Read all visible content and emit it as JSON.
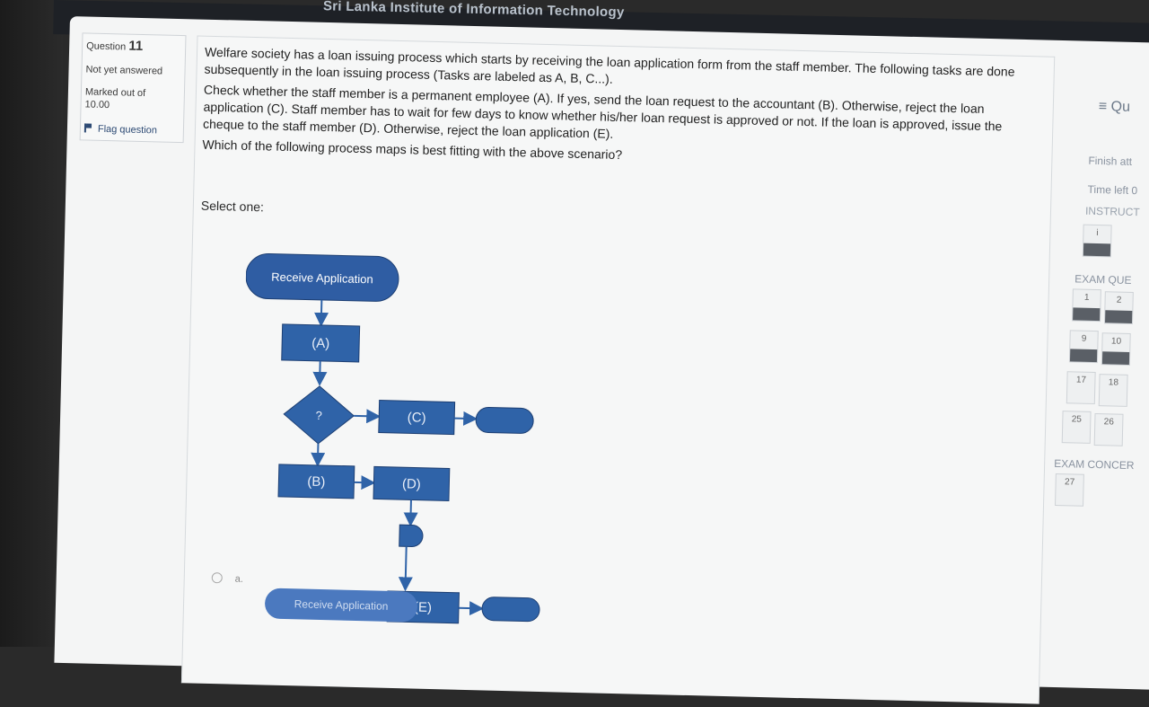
{
  "header": {
    "title": "Sri Lanka Institute of Information Technology"
  },
  "question_info": {
    "label": "Question",
    "number": "11",
    "status": "Not yet answered",
    "marked_label": "Marked out of",
    "marked_value": "10.00",
    "flag_label": "Flag question"
  },
  "question": {
    "p1": "Welfare society has a loan issuing process which starts by receiving the loan application form from the staff member. The following tasks are done subsequently in the loan issuing process (Tasks are labeled as A, B, C...).",
    "p2": "Check whether the staff member is a permanent employee (A). If yes, send the loan request to the accountant (B). Otherwise, reject the loan application (C). Staff member has to wait for few days to know whether his/her loan request is approved or not. If the loan is approved, issue the cheque to the staff member (D). Otherwise, reject the loan application (E).",
    "p3": "Which of the following process maps is best fitting with the above scenario?",
    "select_label": "Select one:"
  },
  "flow": {
    "start": "Receive Application",
    "a": "(A)",
    "decision": "?",
    "c": "(C)",
    "b": "(B)",
    "d": "(D)",
    "e": "(E)"
  },
  "options": {
    "a_label": "a.",
    "next_start": "Receive Application"
  },
  "right_panel": {
    "quiz": "≡ Qu",
    "finish": "Finish att",
    "time_left": "Time left 0",
    "instructions": "INSTRUCT",
    "instr_num": "i",
    "exam_questions": "EXAM QUE",
    "nav_numbers": [
      "1",
      "2",
      "9",
      "10",
      "17",
      "18",
      "25",
      "26"
    ],
    "exam_concern": "EXAM CONCER",
    "concern_num": "27"
  },
  "colors": {
    "flow_blue": "#2f63a8",
    "pill_blue": "#2f63a8"
  }
}
